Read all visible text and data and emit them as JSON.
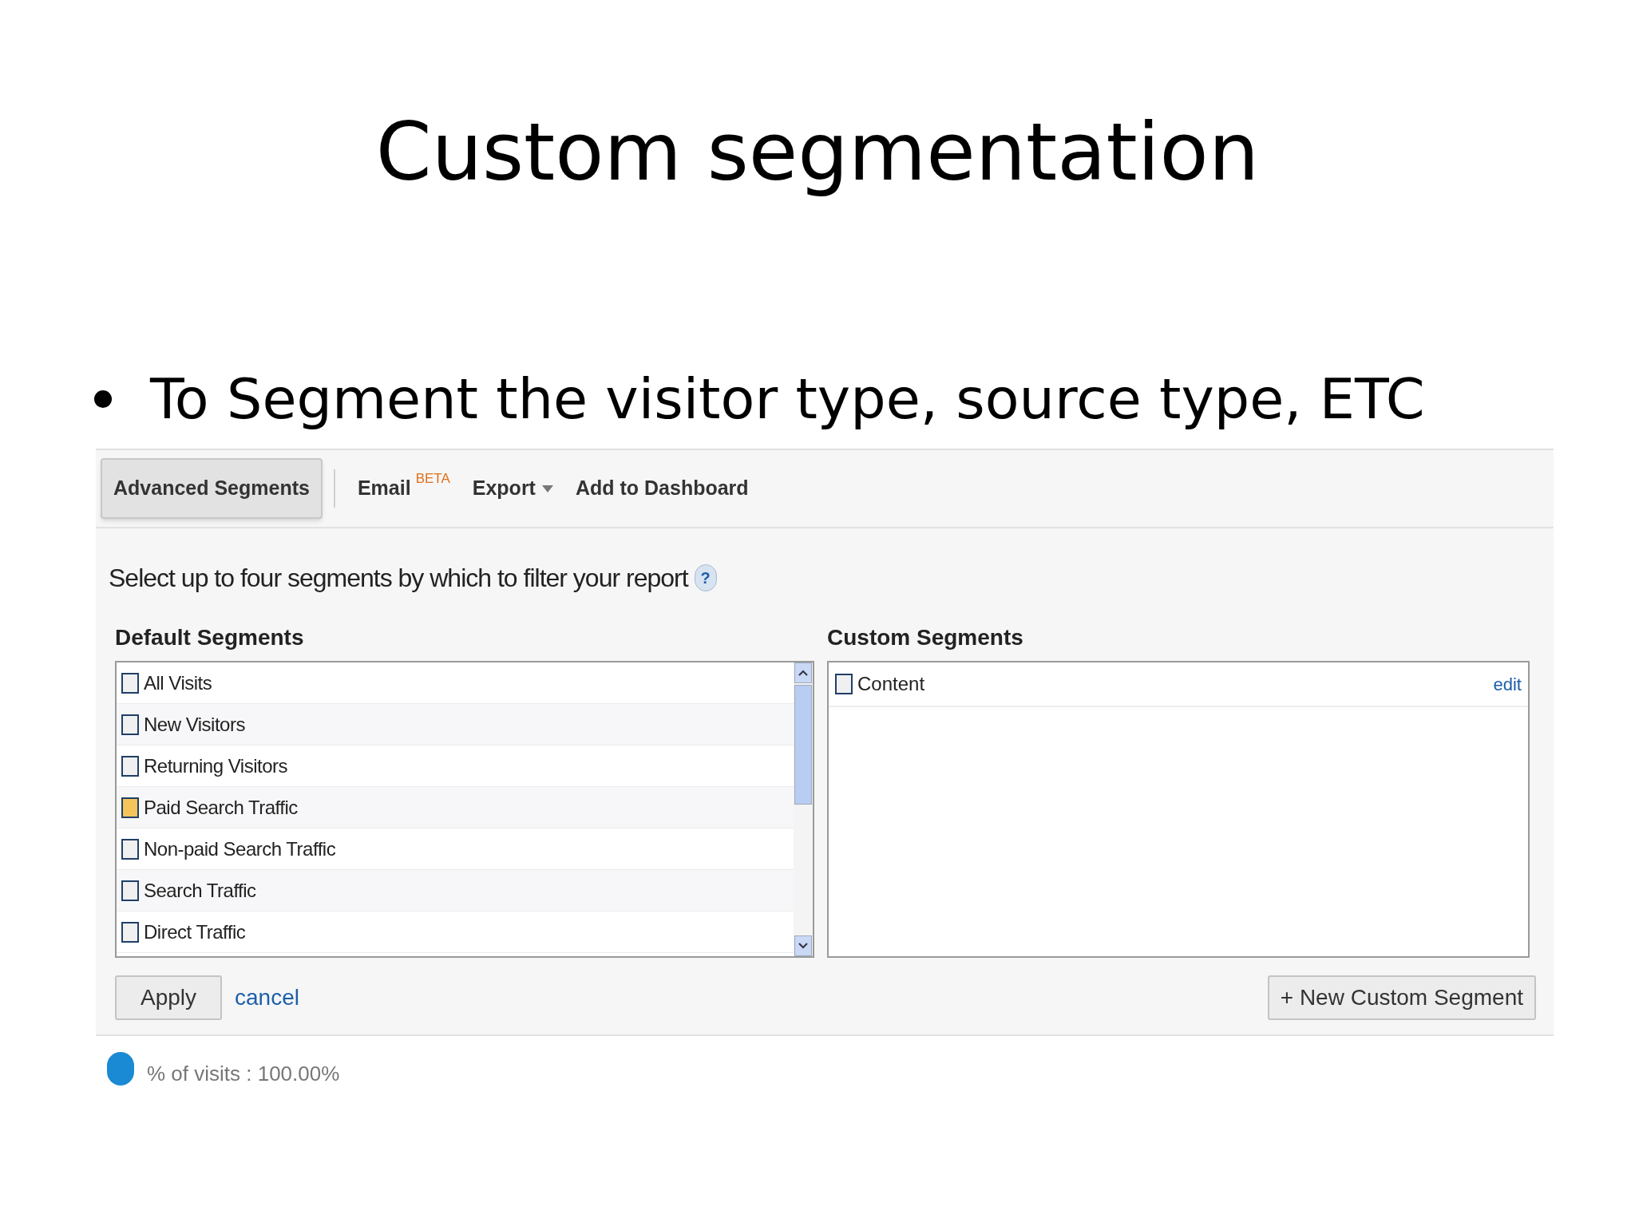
{
  "slide": {
    "title": "Custom segmentation",
    "bullets": [
      "To Segment the visitor type, source type, ETC"
    ]
  },
  "toolbar": {
    "items": [
      {
        "kind": "button",
        "label": "Advanced Segments",
        "selected": true
      },
      {
        "kind": "link",
        "label": "Email",
        "badge": "BETA",
        "selected": false
      },
      {
        "kind": "menu",
        "label": "Export",
        "selected": false
      },
      {
        "kind": "link",
        "label": "Add to Dashboard",
        "selected": false
      }
    ]
  },
  "instruction": "Select up to four segments by which to filter your report",
  "help": "?",
  "default_segments": {
    "heading": "Default Segments",
    "items": [
      {
        "label": "All Visits",
        "checked": false,
        "highlighted": false
      },
      {
        "label": "New Visitors",
        "checked": false,
        "highlighted": false
      },
      {
        "label": "Returning Visitors",
        "checked": false,
        "highlighted": false
      },
      {
        "label": "Paid Search Traffic",
        "checked": false,
        "highlighted": true
      },
      {
        "label": "Non-paid Search Traffic",
        "checked": false,
        "highlighted": false
      },
      {
        "label": "Search Traffic",
        "checked": false,
        "highlighted": false
      },
      {
        "label": "Direct Traffic",
        "checked": false,
        "highlighted": false
      }
    ]
  },
  "custom_segments": {
    "heading": "Custom Segments",
    "items": [
      {
        "label": "Content",
        "checked": false,
        "action": "edit"
      }
    ]
  },
  "buttons": {
    "apply": "Apply",
    "cancel": "cancel",
    "new_segment": "+ New Custom Segment"
  },
  "legend": {
    "label": "% of visits : 100.00%",
    "color": "#1a8ad4"
  }
}
